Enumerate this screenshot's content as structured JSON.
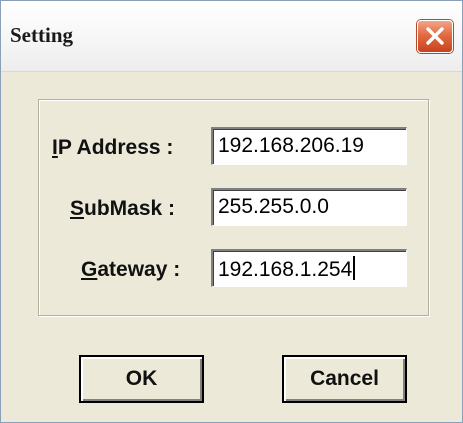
{
  "window": {
    "title": "Setting"
  },
  "fields": {
    "ip_address": {
      "label_mnemonic": "I",
      "label_rest": "P Address :",
      "value": "192.168.206.19"
    },
    "submask": {
      "label_mnemonic": "S",
      "label_rest": "ubMask :",
      "value": "255.255.0.0"
    },
    "gateway": {
      "label_mnemonic": "G",
      "label_rest": "ateway :",
      "value": "192.168.1.254"
    }
  },
  "buttons": {
    "ok_label": "OK",
    "cancel_label": "Cancel"
  },
  "icons": {
    "close": "close-icon"
  },
  "colors": {
    "dialog_background": "#ece9d8",
    "close_button": "#e36a41"
  }
}
